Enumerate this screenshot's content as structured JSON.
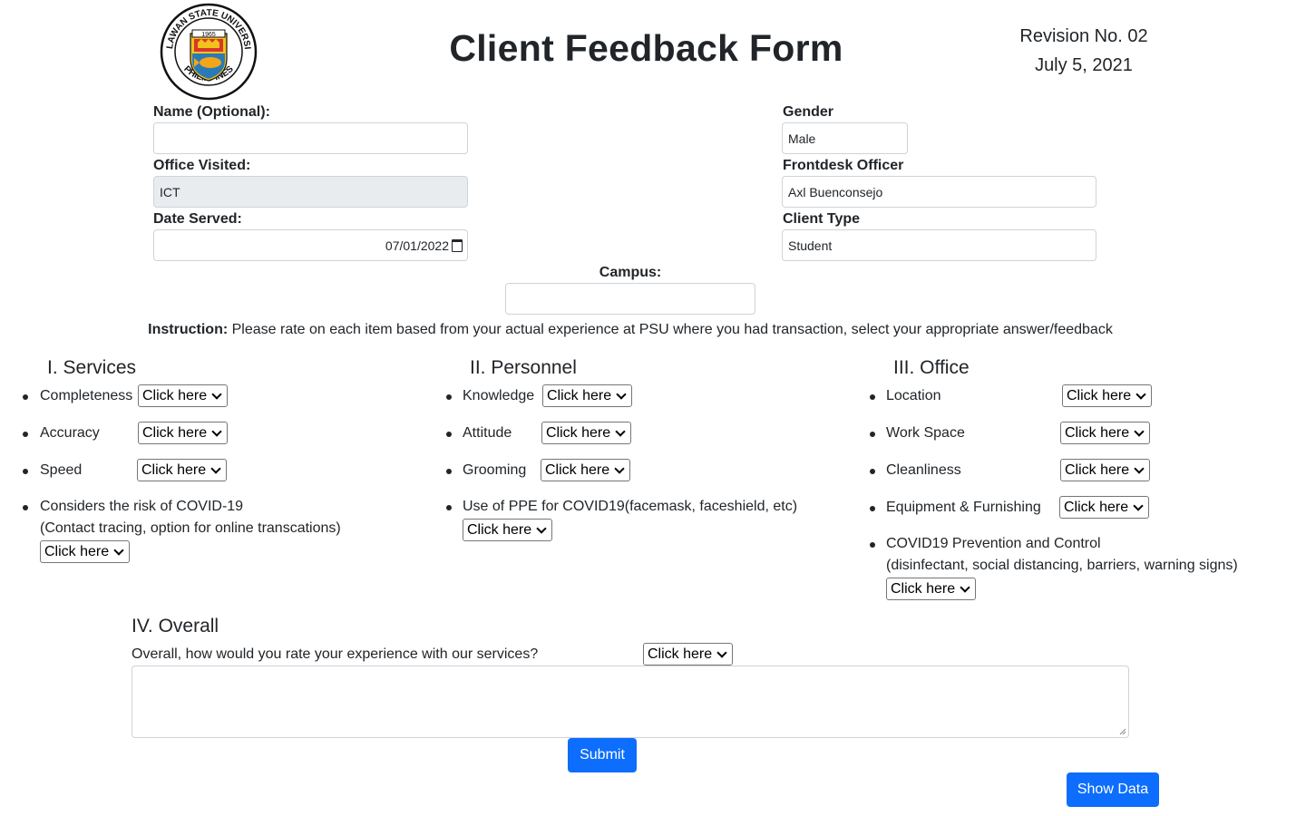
{
  "header": {
    "title": "Client Feedback Form",
    "revision": "Revision No. 02",
    "revision_date": "July 5, 2021",
    "logo": {
      "top_text": "PALAWAN STATE UNIVERSITY",
      "bottom_text": "PHILIPPINES",
      "year": "1965"
    }
  },
  "fields": {
    "name": {
      "label": "Name (Optional):",
      "value": ""
    },
    "office": {
      "label": "Office Visited:",
      "value": "ICT"
    },
    "date": {
      "label": "Date Served:",
      "value": "07/01/2022"
    },
    "gender": {
      "label": "Gender",
      "value": "Male"
    },
    "frontdesk": {
      "label": "Frontdesk Officer",
      "value": "Axl Buenconsejo"
    },
    "client_type": {
      "label": "Client Type",
      "value": "Student"
    },
    "campus": {
      "label": "Campus:",
      "value": ""
    }
  },
  "instruction": {
    "bold": "Instruction:",
    "text": " Please rate on each item based from your actual experience at PSU where you had transaction, select your appropriate answer/feedback"
  },
  "select_placeholder": "Click here",
  "services": {
    "heading": "I. Services",
    "items": [
      "Completeness",
      "Accuracy",
      "Speed",
      "Considers the risk of COVID-19",
      "(Contact tracing, option for online transcations)"
    ]
  },
  "personnel": {
    "heading": "II. Personnel",
    "items": [
      "Knowledge",
      "Attitude",
      "Grooming",
      "Use of PPE for COVID19(facemask, faceshield, etc)"
    ]
  },
  "office": {
    "heading": "III. Office",
    "items": [
      "Location",
      "Work Space",
      "Cleanliness",
      "Equipment & Furnishing",
      "COVID19 Prevention and Control",
      "(disinfectant, social distancing, barriers, warning signs)"
    ]
  },
  "overall": {
    "heading": "IV. Overall",
    "question": "Overall, how would you rate your experience with our services?",
    "comment": ""
  },
  "buttons": {
    "submit": "Submit",
    "show_data": "Show Data"
  },
  "colors": {
    "primary": "#0d6efd",
    "text": "#212529",
    "readonly_bg": "#e9ecef"
  }
}
